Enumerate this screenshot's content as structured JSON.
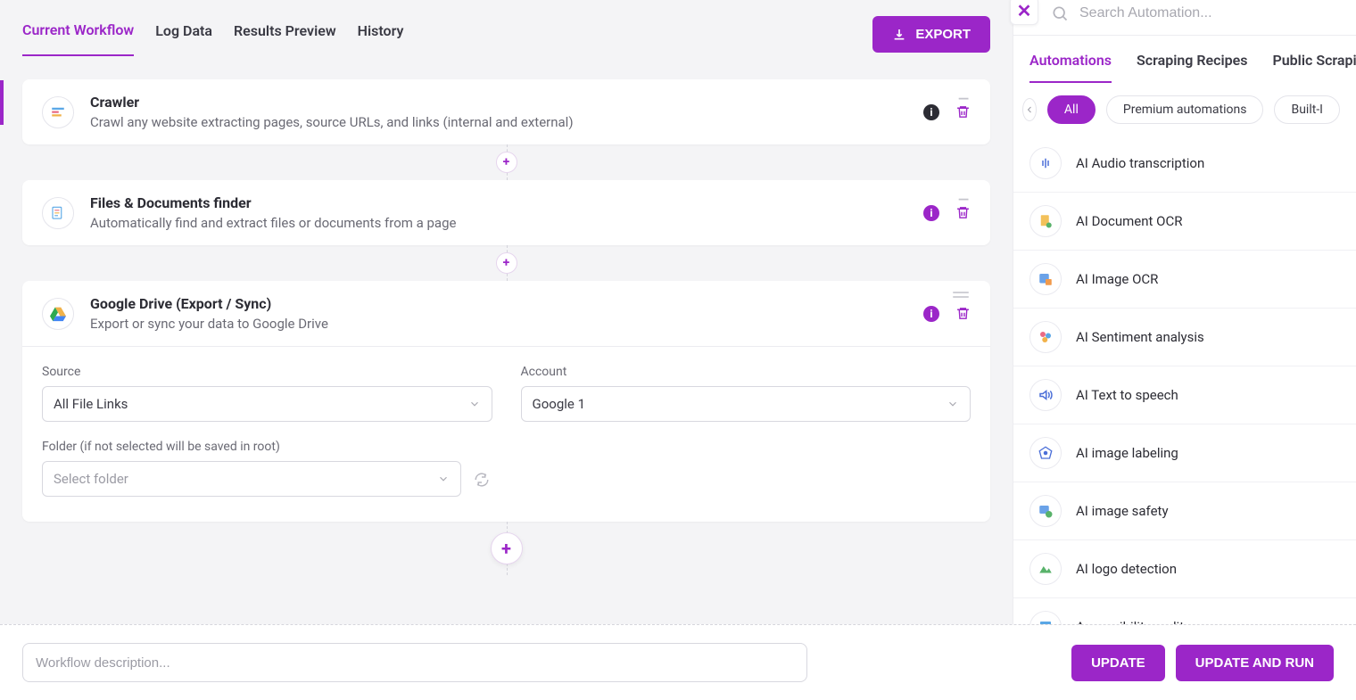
{
  "tabs": {
    "current_workflow": "Current Workflow",
    "log_data": "Log Data",
    "results_preview": "Results Preview",
    "history": "History"
  },
  "export_label": "EXPORT",
  "cards": {
    "crawler": {
      "title": "Crawler",
      "desc": "Crawl any website extracting pages, source URLs, and links (internal and external)"
    },
    "files_finder": {
      "title": "Files & Documents finder",
      "desc": "Automatically find and extract files or documents from a page"
    },
    "gdrive": {
      "title": "Google Drive (Export / Sync)",
      "desc": "Export or sync your data to Google Drive",
      "fields": {
        "source_label": "Source",
        "source_value": "All File Links",
        "account_label": "Account",
        "account_value": "Google 1",
        "folder_label": "Folder (if not selected will be saved in root)",
        "folder_placeholder": "Select folder"
      }
    }
  },
  "bottom": {
    "desc_placeholder": "Workflow description...",
    "update": "UPDATE",
    "update_run": "UPDATE AND RUN"
  },
  "side": {
    "search_placeholder": "Search Automation...",
    "tabs": {
      "automations": "Automations",
      "scraping": "Scraping Recipes",
      "public": "Public Scrapi"
    },
    "filters": {
      "all": "All",
      "premium": "Premium automations",
      "builtin": "Built-I"
    },
    "items": {
      "audio": "AI Audio transcription",
      "doc_ocr": "AI Document OCR",
      "image_ocr": "AI Image OCR",
      "sentiment": "AI Sentiment analysis",
      "tts": "AI Text to speech",
      "image_labeling": "AI image labeling",
      "image_safety": "AI image safety",
      "logo": "AI logo detection",
      "accessibility": "Accessibility audit"
    }
  }
}
